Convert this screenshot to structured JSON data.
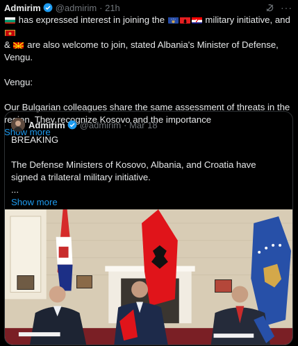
{
  "tweet": {
    "author": "Admirim",
    "handle": "@admirim",
    "time": "· 21h",
    "line1_a": "has expressed interest in joining the",
    "line1_b": "military initiative, and",
    "line2": "& ",
    "line2_b": "are also welcome to join, stated Albania's Minister of Defense, Vengu.",
    "para2": "Vengu:",
    "para3": "Our Bulgarian colleagues share the same assessment of threats in the region. They recognize Kosovo and the importance",
    "show_more": "Show more",
    "flags": [
      "bulgaria",
      "kosovo",
      "albania",
      "croatia",
      "montenegro",
      "north-macedonia"
    ]
  },
  "quote": {
    "author": "Admirim",
    "handle": "@admirim",
    "date": "· Mar 18",
    "line1": "BREAKING",
    "line2": "The Defense Ministers of Kosovo, Albania, and Croatia have signed a trilateral military initiative.",
    "line3": "...",
    "show_more": "Show more"
  },
  "colors": {
    "background": "#000000",
    "text": "#e7e9ea",
    "muted": "#71767b",
    "link": "#1d9bf0",
    "border": "#2f3336",
    "verified": "#1d9bf0"
  }
}
